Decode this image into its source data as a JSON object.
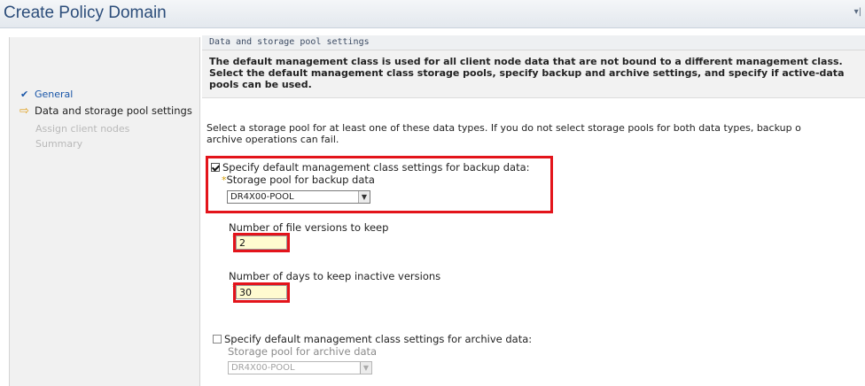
{
  "window": {
    "title": "Create Policy Domain",
    "menu_toggle": "▾|"
  },
  "wizard_nav": {
    "items": [
      {
        "label": "General",
        "state": "completed",
        "icon": "checkmark-icon"
      },
      {
        "label": "Data and storage pool settings",
        "state": "current",
        "icon": "arrow-right-icon"
      },
      {
        "label": "Assign client nodes",
        "state": "disabled"
      },
      {
        "label": "Summary",
        "state": "disabled"
      }
    ]
  },
  "section": {
    "header": "Data and storage pool settings",
    "intro": "The default management class is used for all client node data that are not bound to a different management class. Select the default management class storage pools, specify backup and archive settings, and specify if active-data pools can be used.",
    "instruction_line1": "Select a storage pool for at least one of these data types. If you do not select storage pools for both data types, backup o",
    "instruction_line2": "archive operations can fail."
  },
  "backup": {
    "checkbox_label": "Specify default management class settings for backup data:",
    "checked": true,
    "pool_label": "Storage pool for backup data",
    "pool_value": "DR4X00-POOL",
    "versions_label": "Number of file versions to keep",
    "versions_value": "2",
    "days_label": "Number of days to keep inactive versions",
    "days_value": "30"
  },
  "archive": {
    "checkbox_label": "Specify default management class settings for archive data:",
    "checked": false,
    "pool_label": "Storage pool for archive data",
    "pool_value": "DR4X00-POOL"
  },
  "colors": {
    "highlight": "#e3141b",
    "title": "#2c4d7a",
    "link": "#1a56a8",
    "required": "#d49b00",
    "input_bg": "#fffbd0"
  }
}
